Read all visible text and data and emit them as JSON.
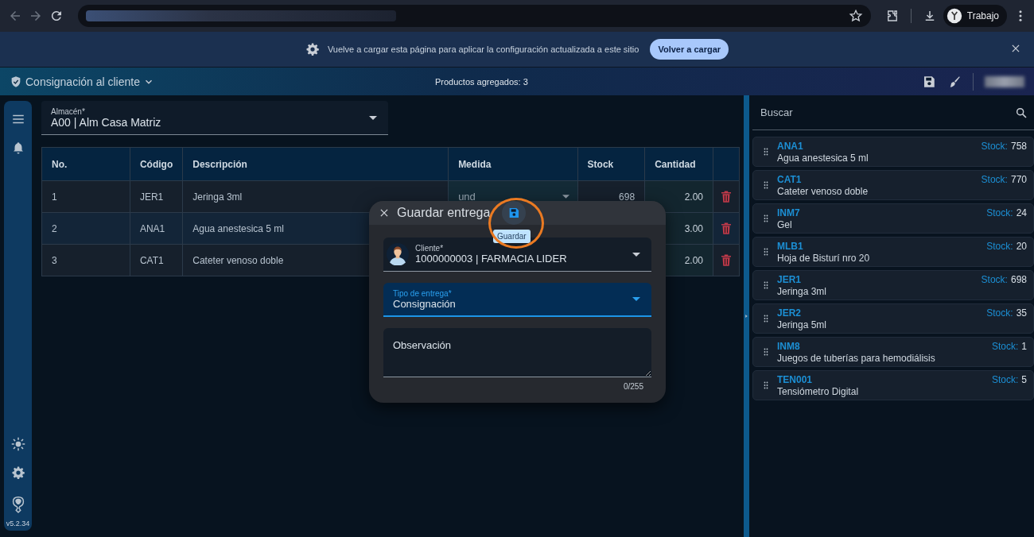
{
  "browser": {
    "profile": "Trabajo"
  },
  "infobar": {
    "message": "Vuelve a cargar esta página para aplicar la configuración actualizada a este sitio",
    "button": "Volver a cargar"
  },
  "app_bar": {
    "title": "Consignación al cliente",
    "status": "Productos agregados: 3"
  },
  "sidebar": {
    "version": "v5.2.34"
  },
  "warehouse_field": {
    "label": "Almacén*",
    "value": "A00 | Alm Casa Matriz"
  },
  "table": {
    "columns": [
      "No.",
      "Código",
      "Descripción",
      "Medida",
      "Stock",
      "Cantidad"
    ],
    "rows": [
      {
        "no": "1",
        "code": "JER1",
        "description": "Jeringa 3ml",
        "unit": "und",
        "stock": "698",
        "quantity": "2.00"
      },
      {
        "no": "2",
        "code": "ANA1",
        "description": "Agua anestesica 5 ml",
        "quantity": "3.00"
      },
      {
        "no": "3",
        "code": "CAT1",
        "description": "Cateter venoso doble",
        "quantity": "2.00"
      }
    ]
  },
  "search": {
    "placeholder": "Buscar"
  },
  "products": [
    {
      "code": "ANA1",
      "name": "Agua anestesica 5 ml",
      "stock_label": "Stock:",
      "stock": "758"
    },
    {
      "code": "CAT1",
      "name": "Cateter venoso doble",
      "stock_label": "Stock:",
      "stock": "770"
    },
    {
      "code": "INM7",
      "name": "Gel",
      "stock_label": "Stock:",
      "stock": "24"
    },
    {
      "code": "MLB1",
      "name": "Hoja de Bisturí nro 20",
      "stock_label": "Stock:",
      "stock": "20"
    },
    {
      "code": "JER1",
      "name": "Jeringa 3ml",
      "stock_label": "Stock:",
      "stock": "698"
    },
    {
      "code": "JER2",
      "name": "Jeringa 5ml",
      "stock_label": "Stock:",
      "stock": "35"
    },
    {
      "code": "INM8",
      "name": "Juegos de tuberías para hemodiálisis",
      "stock_label": "Stock:",
      "stock": "1"
    },
    {
      "code": "TEN001",
      "name": "Tensiómetro Digital",
      "stock_label": "Stock:",
      "stock": "5"
    }
  ],
  "dialog": {
    "title": "Guardar entrega",
    "tooltip": "Guardar",
    "fields": [
      {
        "kind": "avatar-select",
        "label": "Cliente*",
        "value": "1000000003 | FARMACIA LIDER",
        "focused": false
      },
      {
        "kind": "select",
        "label": "Tipo de entrega*",
        "value": "Consignación",
        "focused": true
      },
      {
        "kind": "textarea",
        "placeholder": "Observación",
        "counter": "0/255"
      }
    ]
  }
}
